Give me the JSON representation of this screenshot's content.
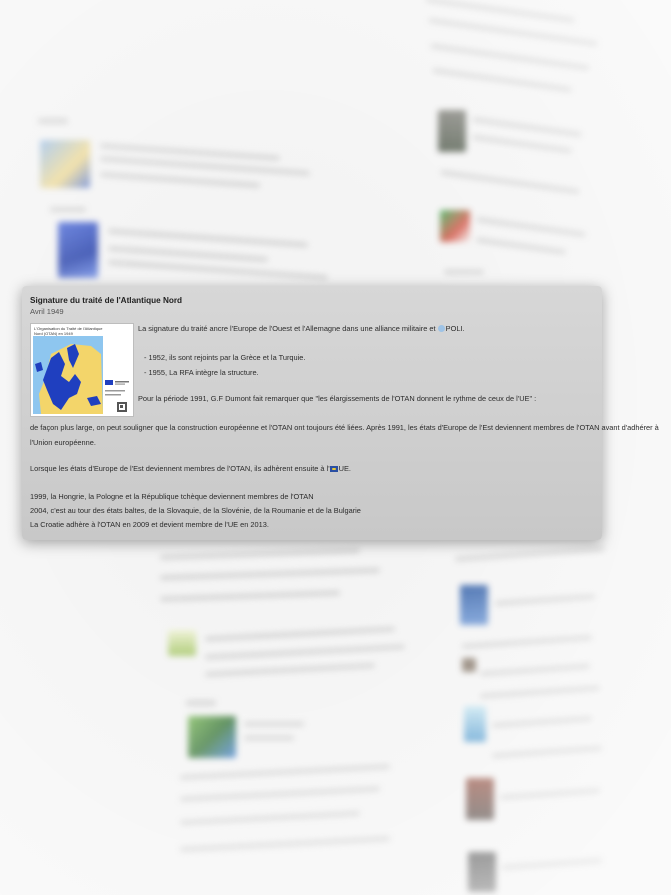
{
  "card": {
    "title": "Signature du traité de l'Atlantique Nord",
    "date": "Avril 1949",
    "map_caption": "L'Organisation du Traité de l'Atlantique Nord (OTAN) en 1949",
    "intro_text": "La signature du traité ancre l'Europe de l'Ouest et l'Allemagne dans une alliance militaire et",
    "intro_link": "POLI.",
    "bullet_1": "- 1952, ils sont rejoints par la Grèce et la Turquie.",
    "bullet_2": "- 1955, La RFA intègre la structure.",
    "quote_line": "Pour la période 1991, G.F Dumont fait remarquer que \"les élargissements de l'OTAN donnent le rythme de ceux de l'UE\" :",
    "para_1a": "de façon plus large, on peut souligner que la construction européenne et l'OTAN ont toujours été liées. Après 1991, les états d'Europe de l'Est deviennent membres de l'OTAN avant d'adhérer à",
    "para_1b": "l'Union européenne.",
    "para_2_pre": "Lorsque les états d'Europe de l'Est deviennent membres de l'OTAN, ils adhèrent ensuite à l'",
    "para_2_link": "UE.",
    "para_3a": "1999, la Hongrie, la Pologne et la République tchèque deviennent membres de l'OTAN",
    "para_3b": "2004, c'est au tour des états baltes, de la Slovaquie, de la Slovénie, de la Roumanie et de la Bulgarie",
    "para_3c": "La Croatie adhère à l'OTAN en 2009 et devient membre de l'UE en 2013."
  },
  "icons": {
    "poli": "globe-icon",
    "ue": "eu-flag-icon"
  },
  "colors": {
    "card_bg": "#d0d0d0",
    "map_sea": "#8ec6ef",
    "map_nato": "#1f3fbf",
    "map_land": "#f3d56a"
  }
}
